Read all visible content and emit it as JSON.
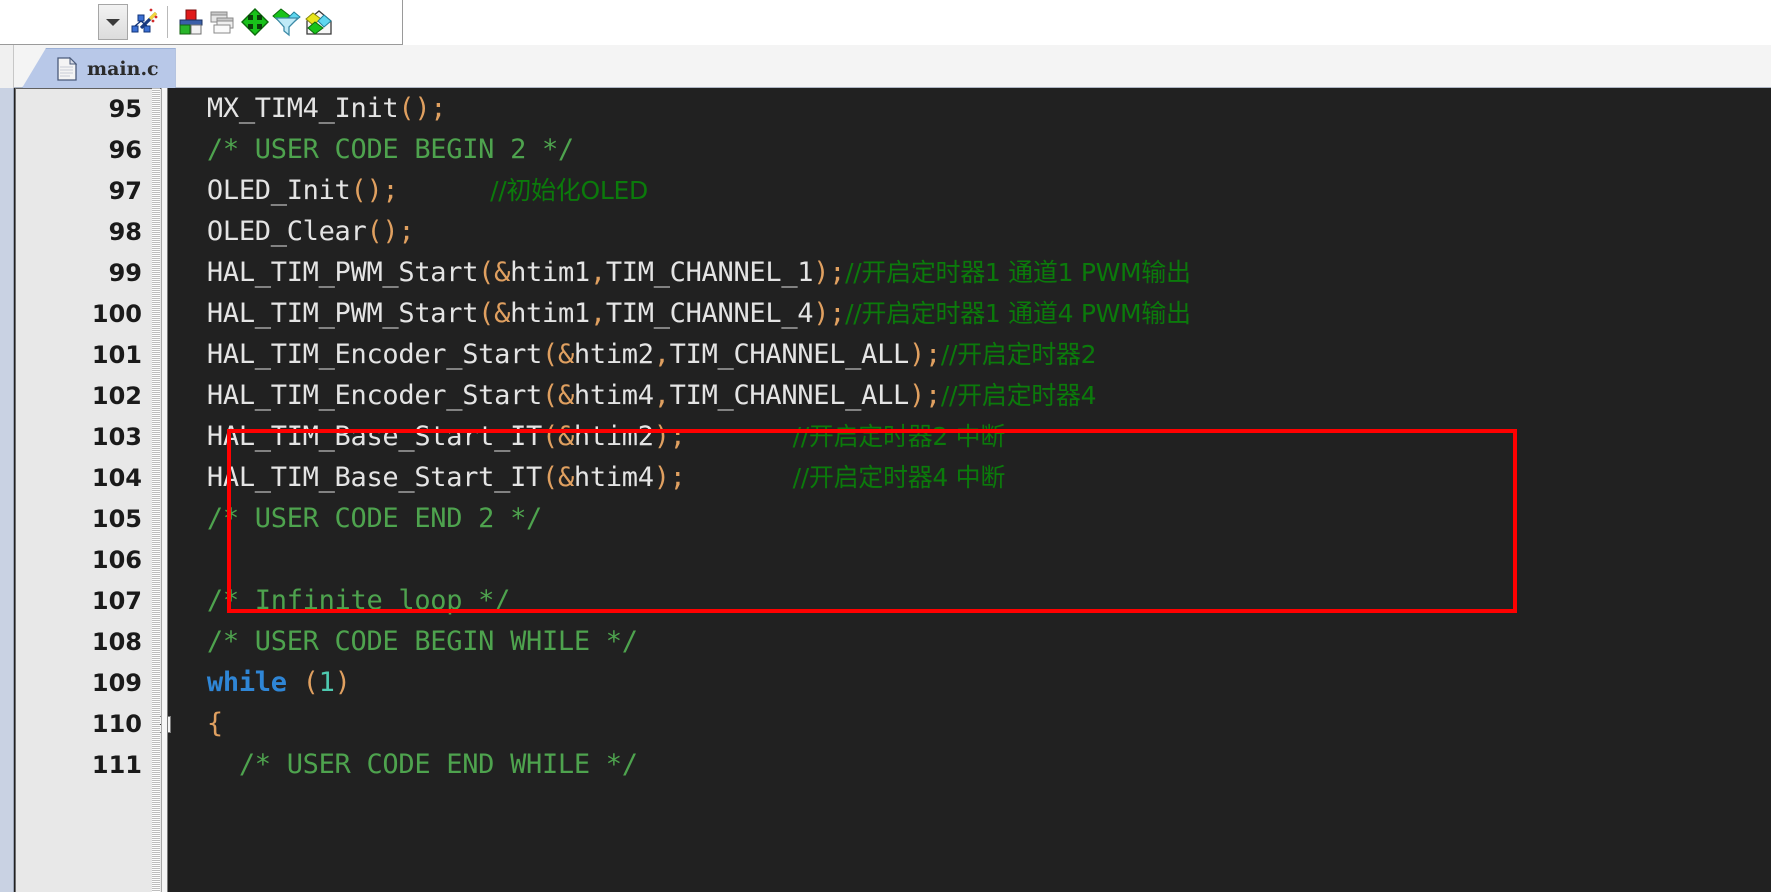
{
  "window": {
    "kind": "ide-code-editor"
  },
  "toolbar": {
    "items": [
      {
        "name": "dropdown-arrow-button",
        "icon": "chevron-down-icon",
        "label": ""
      },
      {
        "name": "magic-wand-button",
        "icon": "magic-wand-icon",
        "label": ""
      },
      {
        "name": "build-target-button",
        "icon": "build-blocks-icon",
        "label": ""
      },
      {
        "name": "manage-windows-button",
        "icon": "windows-stack-icon",
        "label": ""
      },
      {
        "name": "configuration-wizard-button",
        "icon": "green-diamond-icon",
        "label": ""
      },
      {
        "name": "filter-button",
        "icon": "funnel-diamond-icon",
        "label": ""
      },
      {
        "name": "package-installer-button",
        "icon": "package-diamond-icon",
        "label": ""
      }
    ]
  },
  "tabs": {
    "active_index": 0,
    "items": [
      {
        "label": "main.c",
        "icon": "c-file-icon"
      }
    ]
  },
  "editor": {
    "first_line": 95,
    "background": "#212121",
    "gutter_background": "#e8e8e8",
    "colors": {
      "identifier": "#e4e4e4",
      "punctuation": "#e0a060",
      "number": "#4ec9b0",
      "keyword": "#2f86d6",
      "block_comment": "#4ea34e",
      "line_comment": "#0b7a0b",
      "annotation_box": "#ff0000"
    },
    "lines": [
      {
        "n": "95",
        "fold": false,
        "tokens": [
          {
            "t": "ident",
            "v": "  MX_TIM4_Init"
          },
          {
            "t": "punct",
            "v": "();"
          }
        ]
      },
      {
        "n": "96",
        "fold": false,
        "tokens": [
          {
            "t": "cmt-block",
            "v": "  /* USER CODE BEGIN 2 */"
          }
        ]
      },
      {
        "n": "97",
        "fold": false,
        "tokens": [
          {
            "t": "ident",
            "v": "  OLED_Init"
          },
          {
            "t": "punct",
            "v": "();"
          },
          {
            "t": "cmt-cn",
            "v": "            //初始化OLED"
          }
        ]
      },
      {
        "n": "98",
        "fold": false,
        "tokens": [
          {
            "t": "ident",
            "v": "  OLED_Clear"
          },
          {
            "t": "punct",
            "v": "();"
          }
        ]
      },
      {
        "n": "99",
        "fold": false,
        "tokens": [
          {
            "t": "ident",
            "v": "  HAL_TIM_PWM_Start"
          },
          {
            "t": "punct",
            "v": "(&"
          },
          {
            "t": "ident",
            "v": "htim1"
          },
          {
            "t": "punct",
            "v": ","
          },
          {
            "t": "ident",
            "v": "TIM_CHANNEL_1"
          },
          {
            "t": "punct",
            "v": ");"
          },
          {
            "t": "cmt-cn",
            "v": "//开启定时器1 通道1 PWM输出"
          }
        ]
      },
      {
        "n": "100",
        "fold": false,
        "tokens": [
          {
            "t": "ident",
            "v": "  HAL_TIM_PWM_Start"
          },
          {
            "t": "punct",
            "v": "(&"
          },
          {
            "t": "ident",
            "v": "htim1"
          },
          {
            "t": "punct",
            "v": ","
          },
          {
            "t": "ident",
            "v": "TIM_CHANNEL_4"
          },
          {
            "t": "punct",
            "v": ");"
          },
          {
            "t": "cmt-cn",
            "v": "//开启定时器1 通道4 PWM输出"
          }
        ]
      },
      {
        "n": "101",
        "fold": false,
        "tokens": [
          {
            "t": "ident",
            "v": "  HAL_TIM_Encoder_Start"
          },
          {
            "t": "punct",
            "v": "(&"
          },
          {
            "t": "ident",
            "v": "htim2"
          },
          {
            "t": "punct",
            "v": ","
          },
          {
            "t": "ident",
            "v": "TIM_CHANNEL_ALL"
          },
          {
            "t": "punct",
            "v": ");"
          },
          {
            "t": "cmt-cn",
            "v": "//开启定时器2"
          }
        ]
      },
      {
        "n": "102",
        "fold": false,
        "tokens": [
          {
            "t": "ident",
            "v": "  HAL_TIM_Encoder_Start"
          },
          {
            "t": "punct",
            "v": "(&"
          },
          {
            "t": "ident",
            "v": "htim4"
          },
          {
            "t": "punct",
            "v": ","
          },
          {
            "t": "ident",
            "v": "TIM_CHANNEL_ALL"
          },
          {
            "t": "punct",
            "v": ");"
          },
          {
            "t": "cmt-cn",
            "v": "//开启定时器4"
          }
        ]
      },
      {
        "n": "103",
        "fold": false,
        "tokens": [
          {
            "t": "ident",
            "v": "  HAL_TIM_Base_Start_IT"
          },
          {
            "t": "punct",
            "v": "(&"
          },
          {
            "t": "ident",
            "v": "htim2"
          },
          {
            "t": "punct",
            "v": ");"
          },
          {
            "t": "cmt-cn",
            "v": "              //开启定时器2 中断"
          }
        ]
      },
      {
        "n": "104",
        "fold": false,
        "tokens": [
          {
            "t": "ident",
            "v": "  HAL_TIM_Base_Start_IT"
          },
          {
            "t": "punct",
            "v": "(&"
          },
          {
            "t": "ident",
            "v": "htim4"
          },
          {
            "t": "punct",
            "v": ");"
          },
          {
            "t": "cmt-cn",
            "v": "              //开启定时器4 中断"
          }
        ]
      },
      {
        "n": "105",
        "fold": false,
        "tokens": [
          {
            "t": "cmt-block",
            "v": "  /* USER CODE END 2 */"
          }
        ]
      },
      {
        "n": "106",
        "fold": false,
        "tokens": []
      },
      {
        "n": "107",
        "fold": false,
        "tokens": [
          {
            "t": "cmt-block",
            "v": "  /* Infinite loop */"
          }
        ]
      },
      {
        "n": "108",
        "fold": false,
        "tokens": [
          {
            "t": "cmt-block",
            "v": "  /* USER CODE BEGIN WHILE */"
          }
        ]
      },
      {
        "n": "109",
        "fold": false,
        "tokens": [
          {
            "t": "ident",
            "v": "  "
          },
          {
            "t": "kw",
            "v": "while"
          },
          {
            "t": "ident",
            "v": " "
          },
          {
            "t": "punct",
            "v": "("
          },
          {
            "t": "num",
            "v": "1"
          },
          {
            "t": "punct",
            "v": ")"
          }
        ]
      },
      {
        "n": "110",
        "fold": true,
        "tokens": [
          {
            "t": "punct",
            "v": "  {"
          }
        ]
      },
      {
        "n": "111",
        "fold": false,
        "tokens": [
          {
            "t": "cmt-block",
            "v": "    /* USER CODE END WHILE */"
          }
        ]
      }
    ]
  },
  "annotation": {
    "type": "red-rectangle-highlight",
    "covers_lines": [
      "101",
      "102",
      "103",
      "104"
    ],
    "color": "#ff0000"
  }
}
